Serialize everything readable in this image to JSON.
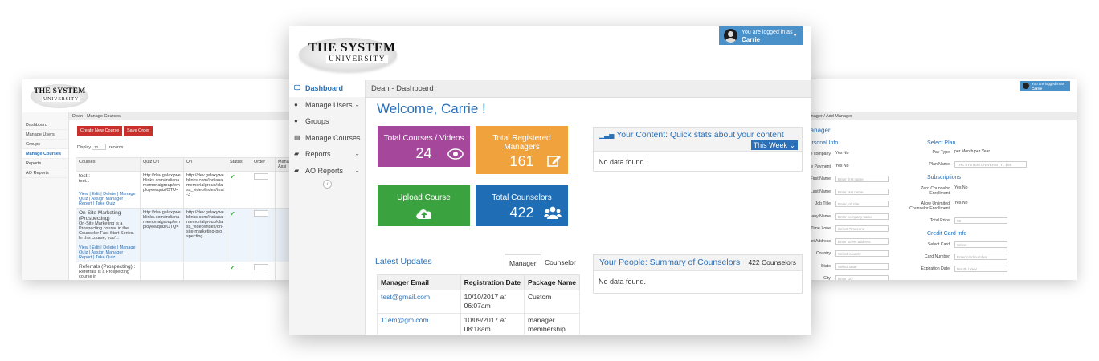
{
  "left_screen": {
    "logo": {
      "line1": "THE SYSTEM",
      "line2": "UNIVERSITY"
    },
    "breadcrumb": "Dean - Manage Courses",
    "nav": [
      "Dashboard",
      "Manage Users",
      "Groups",
      "Manage Courses",
      "Reports",
      "AO Reports"
    ],
    "buttons": {
      "create": "Create New Course",
      "save_order": "Save Order"
    },
    "display_label": "Display",
    "display_value": "10",
    "display_suffix": "records",
    "columns": [
      "Courses",
      "Quiz Url",
      "Url",
      "Status",
      "Order",
      "Mana Assi"
    ],
    "rows": [
      {
        "title": "test :",
        "desc": "test...",
        "quiz_url": "http://dev.galaxyweblinks.com/indianamemorialgroup/employee/quiz/OTU=",
        "url": "http://dev.galaxyweblinks.com/indianamemorialgroup/class_video/index/test-3",
        "actions": "View | Edit | Delete | Manage Quiz | Assign Manager | Report | Take Quiz"
      },
      {
        "title": "On-Site Marketing (Prospecting) :",
        "desc": "On-Site Marketing is a Prospecting course in the Counselor Fast Start Series. In this course, you'...",
        "quiz_url": "http://dev.galaxyweblinks.com/indianamemorialgroup/employee/quiz/OTQ=",
        "url": "http://dev.galaxyweblinks.com/indianamemorialgroup/class_video/index/on-site-marketing-prospecting",
        "actions": "View | Edit | Delete | Manage Quiz | Assign Manager | Report | Take Quiz"
      },
      {
        "title": "Referrals (Prospecting) :",
        "desc": "Referrals is a Prospecting course in",
        "quiz_url": "",
        "url": "",
        "actions": ""
      }
    ]
  },
  "right_screen": {
    "login": {
      "line1": "You are logged in as",
      "line2": "Carrie"
    },
    "breadcrumb": "Manager / Add Manager",
    "heading": "Manager",
    "sections": {
      "personal": "Personal Info",
      "plan": "Select Plan",
      "subs": "Subscriptions",
      "card": "Credit Card Info"
    },
    "left_fields": [
      "One company",
      "One Payment",
      "First Name",
      "Last Name",
      "Job Title",
      "Company Name",
      "Time Zone",
      "Street Address",
      "Country",
      "State",
      "City"
    ],
    "left_inputs": [
      "Yes  No",
      "Yes  No",
      "Enter first name",
      "Enter last name",
      "Enter job title",
      "Enter company name",
      "Select Timezone",
      "Enter street address",
      "Select country",
      "Select state",
      "Enter city"
    ],
    "right_fields": [
      "Pay Type",
      "Plan Name",
      "Zero Counselor Enrollment",
      "Allow Unlimited Counselor Enrollment",
      "Total Price",
      "Select Card",
      "Card Number",
      "Expiration Date"
    ],
    "right_inputs": [
      "per Month  per Year",
      "THE SYSTEM UNIVERSITY : $59",
      "Yes  No",
      "Yes  No",
      "59",
      "Select",
      "Enter card number",
      "Month  /  Year"
    ]
  },
  "main": {
    "logo": {
      "line1": "THE SYSTEM",
      "line2": "UNIVERSITY"
    },
    "login": {
      "line1": "You are logged in as",
      "line2": "Carrie"
    },
    "nav": [
      {
        "label": "Dashboard",
        "icon": "monitor-icon",
        "chev": ""
      },
      {
        "label": "Manage Users",
        "icon": "user-icon",
        "chev": "⌄"
      },
      {
        "label": "Groups",
        "icon": "group-icon",
        "chev": ""
      },
      {
        "label": "Manage Courses",
        "icon": "list-icon",
        "chev": ""
      },
      {
        "label": "Reports",
        "icon": "folder-icon",
        "chev": "⌄"
      },
      {
        "label": "AO Reports",
        "icon": "folder-icon",
        "chev": "⌄"
      }
    ],
    "breadcrumb": "Dean - Dashboard",
    "welcome": "Welcome, Carrie !",
    "tiles": {
      "courses": {
        "title": "Total Courses / Videos",
        "value": "24",
        "color": "#a5479a"
      },
      "managers": {
        "title_1": "Total Registered",
        "title_2": "Managers",
        "value": "161",
        "color": "#f0a33c"
      },
      "upload": {
        "title": "Upload Course",
        "color": "#3aa23e"
      },
      "counselors": {
        "title": "Total Counselors",
        "value": "422",
        "color": "#1f6db5"
      }
    },
    "content_panel": {
      "title": "Your Content: Quick stats about your content",
      "filter": "This Week ⌄",
      "body": "No data found."
    },
    "people_panel": {
      "title": "Your People: Summary of Counselors",
      "count": "422 Counselors",
      "body": "No data found."
    },
    "updates": {
      "title": "Latest Updates",
      "tabs": [
        "Manager",
        "Counselor"
      ],
      "columns": [
        "Manager Email",
        "Registration Date",
        "Package Name"
      ],
      "rows": [
        {
          "email": "test@gmail.com",
          "date": "10/10/2017",
          "at": "at",
          "time": "06:07am",
          "package": "Custom"
        },
        {
          "email": "11em@gm.com",
          "date": "10/09/2017",
          "at": "at",
          "time": "08:18am",
          "package": "manager membership"
        }
      ]
    }
  }
}
